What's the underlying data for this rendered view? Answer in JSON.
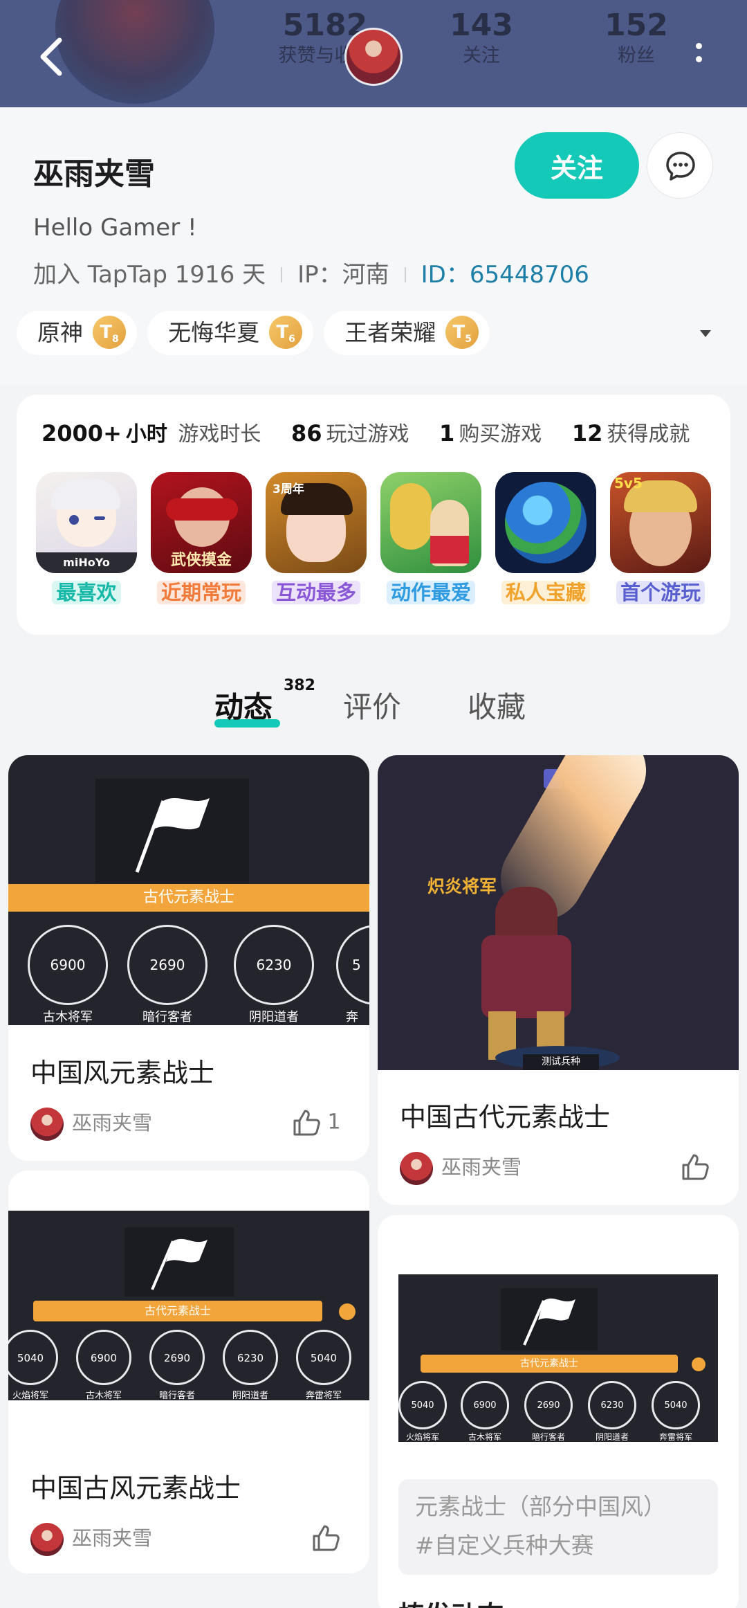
{
  "header": {
    "stats": [
      {
        "value": "5182",
        "label": "获赞与收藏"
      },
      {
        "value": "143",
        "label": "关注"
      },
      {
        "value": "152",
        "label": "粉丝"
      }
    ]
  },
  "profile": {
    "username": "巫雨夹雪",
    "follow_label": "关注",
    "bio": "Hello Gamer !",
    "joined": "加入 TapTap 1916 天",
    "ip": "IP：河南",
    "id": "ID：65448706",
    "tags": [
      {
        "name": "原神",
        "level": "8"
      },
      {
        "name": "无悔华夏",
        "level": "6"
      },
      {
        "name": "王者荣耀",
        "level": "5"
      }
    ]
  },
  "game_stats": {
    "items": [
      {
        "value": "2000+",
        "unit": "小时",
        "label": "游戏时长"
      },
      {
        "value": "86",
        "unit": "",
        "label": "玩过游戏"
      },
      {
        "value": "1",
        "unit": "",
        "label": "购买游戏"
      },
      {
        "value": "12",
        "unit": "",
        "label": "获得成就"
      }
    ],
    "games": [
      {
        "label": "最喜欢",
        "color": "#16b9a8",
        "bg": "#d9f6f1",
        "icon_text": "miHoYo"
      },
      {
        "label": "近期常玩",
        "color": "#f07b3b",
        "bg": "#fde7dc",
        "icon_text": "武侠摸金"
      },
      {
        "label": "互动最多",
        "color": "#8a58d6",
        "bg": "#ece2fa",
        "icon_text": "3周年"
      },
      {
        "label": "动作最爱",
        "color": "#2f9be0",
        "bg": "#dcefff",
        "icon_text": ""
      },
      {
        "label": "私人宝藏",
        "color": "#f0a22a",
        "bg": "#fdf0d6",
        "icon_text": ""
      },
      {
        "label": "首个游玩",
        "color": "#5a5fd0",
        "bg": "#e3e4fb",
        "icon_text": "5v5"
      }
    ]
  },
  "tabs": {
    "posts": "动态",
    "posts_count": "382",
    "reviews": "评价",
    "favorites": "收藏"
  },
  "feed": {
    "cards": [
      {
        "title": "中国风元素战士",
        "author": "巫雨夹雪",
        "likes": "1",
        "banner": "古代元素战士",
        "units": [
          {
            "value": "6900",
            "name": "古木将军"
          },
          {
            "value": "2690",
            "name": "暗行客者"
          },
          {
            "value": "6230",
            "name": "阴阳道者"
          },
          {
            "value": "5",
            "name": "奔"
          }
        ]
      },
      {
        "title": "中国古代元素战士",
        "author": "巫雨夹雪",
        "likes": "",
        "caption": "炽炎将军",
        "sub": "测试兵种"
      },
      {
        "title": "中国古风元素战士",
        "author": "巫雨夹雪",
        "likes": "",
        "banner": "古代元素战士",
        "units": [
          {
            "value": "5040",
            "name": "火焰将军"
          },
          {
            "value": "6900",
            "name": "古木将军"
          },
          {
            "value": "2690",
            "name": "暗行客者"
          },
          {
            "value": "6230",
            "name": "阴阳道者"
          },
          {
            "value": "5040",
            "name": "奔雷将军"
          }
        ]
      },
      {
        "banner": "古代元素战士",
        "units": [
          {
            "value": "5040",
            "name": "火焰将军"
          },
          {
            "value": "6900",
            "name": "古木将军"
          },
          {
            "value": "2690",
            "name": "暗行客者"
          },
          {
            "value": "6230",
            "name": "阴阳道者"
          },
          {
            "value": "5040",
            "name": "奔雷将军"
          }
        ],
        "desc_line1": "元素战士（部分中国风）",
        "desc_line2": "#自定义兵种大赛",
        "title": "植发动态"
      }
    ]
  }
}
